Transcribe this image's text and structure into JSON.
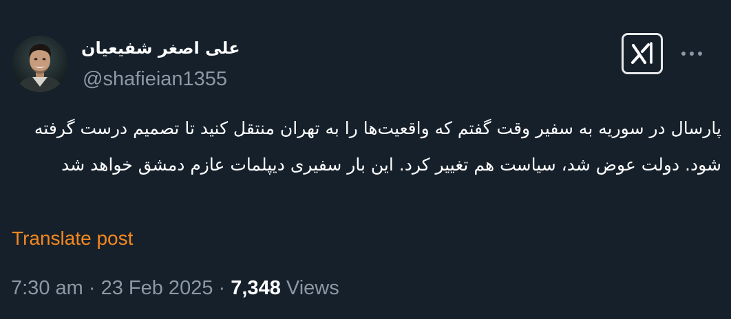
{
  "author": {
    "display_name": "علی اصغر شفیعیان",
    "handle": "@shafieian1355",
    "avatar": "profile-photo"
  },
  "header_actions": {
    "grok_icon": "grok-logo-icon",
    "more_icon": "more-horizontal-icon"
  },
  "tweet": {
    "text": "پارسال در سوریه به سفیر وقت گفتم که واقعیت‌ها را به تهران منتقل کنید تا تصمیم درست گرفته شود. دولت عوض شد، سیاست هم تغییر کرد. این بار سفیری دیپلمات عازم دمشق خواهد شد",
    "translate_label": "Translate post"
  },
  "meta": {
    "time": "7:30 am",
    "separator": "·",
    "date": "23 Feb 2025",
    "views_count": "7,348",
    "views_label": "Views"
  },
  "colors": {
    "background": "#16202b",
    "primary_text": "#ffffff",
    "secondary_text": "#8b98a5",
    "link": "#f4881f"
  }
}
